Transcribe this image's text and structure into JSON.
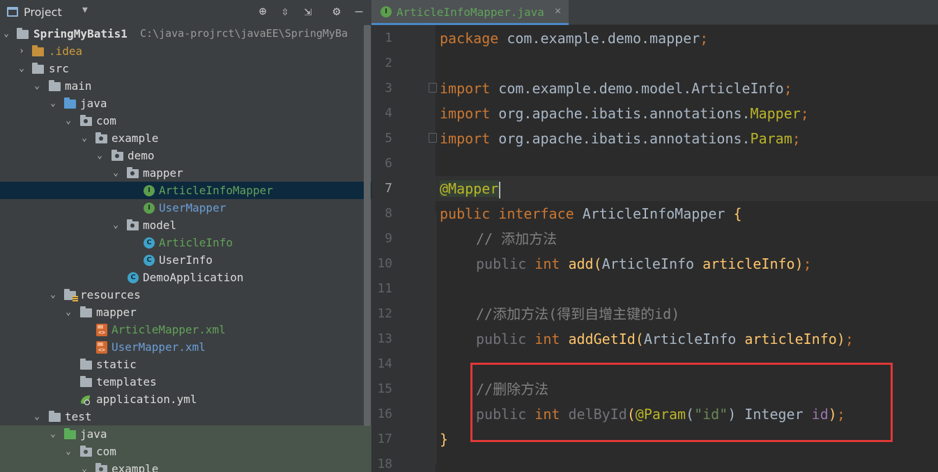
{
  "project_panel": {
    "title": "Project",
    "icons": {
      "dropdown": "chevron-down-icon",
      "locate": "crosshair-icon",
      "expand_all": "expand-all-icon",
      "collapse_all": "collapse-all-icon",
      "settings": "gear-icon",
      "hide": "minimize-icon"
    },
    "root": {
      "name": "SpringMyBatis1",
      "path": "C:\\java-projrct\\javaEE\\SpringMyBa"
    },
    "tree": {
      "idea": ".idea",
      "src": "src",
      "main": "main",
      "java": "java",
      "com": "com",
      "example": "example",
      "demo": "demo",
      "mapper": "mapper",
      "article_info_mapper": "ArticleInfoMapper",
      "user_mapper": "UserMapper",
      "model": "model",
      "article_info": "ArticleInfo",
      "user_info": "UserInfo",
      "demo_application": "DemoApplication",
      "resources": "resources",
      "res_mapper": "mapper",
      "article_mapper_xml": "ArticleMapper.xml",
      "user_mapper_xml": "UserMapper.xml",
      "static": "static",
      "templates": "templates",
      "application_yml": "application.yml",
      "test": "test",
      "test_java": "java",
      "test_com": "com",
      "test_example": "example"
    }
  },
  "editor": {
    "tab": {
      "label": "ArticleInfoMapper.java",
      "close": "✕"
    },
    "line_numbers": [
      "1",
      "2",
      "3",
      "4",
      "5",
      "6",
      "7",
      "8",
      "9",
      "10",
      "11",
      "12",
      "13",
      "14",
      "15",
      "16",
      "17",
      "18"
    ],
    "current_line": "7",
    "code": {
      "l1": {
        "kw": "package",
        "rest": " com.example.demo.mapper",
        "semi": ";"
      },
      "l3": {
        "kw": "import",
        "rest": " com.example.demo.model.ArticleInfo",
        "semi": ";"
      },
      "l4": {
        "kw": "import",
        "rest": " org.apache.ibatis.annotations.",
        "ann": "Mapper",
        "semi": ";"
      },
      "l5": {
        "kw": "import",
        "rest": " org.apache.ibatis.annotations.",
        "ann": "Param",
        "semi": ";"
      },
      "l7": {
        "ann": "@Mapper"
      },
      "l8": {
        "kw1": "public",
        "kw2": " interface",
        "name": " ArticleInfoMapper ",
        "brace": "{"
      },
      "l9": {
        "comment": "// 添加方法"
      },
      "l10": {
        "pub": "public",
        "int": " int",
        "fn": " add",
        "args_open": "(",
        "type": "ArticleInfo",
        "param": " articleInfo",
        "close": ")",
        "semi": ";"
      },
      "l12": {
        "comment": "//添加方法(得到自增主键的id)"
      },
      "l13": {
        "pub": "public",
        "int": " int",
        "fn": " addGetId",
        "args_open": "(",
        "type": "ArticleInfo",
        "param": " articleInfo",
        "close": ")",
        "semi": ";"
      },
      "l15": {
        "comment": "//删除方法"
      },
      "l16": {
        "pub": "public",
        "int": " int",
        "fn": " delById",
        "args_open": "(",
        "ann": "@Param",
        "str_open": "(",
        "str": "\"id\"",
        "str_close": ")",
        "type": " Integer",
        "param": " id",
        "close": ")",
        "semi": ";"
      },
      "l17": {
        "brace": "}"
      }
    }
  },
  "colors": {
    "keyword": "#cc7832",
    "annotation": "#bbb529",
    "comment": "#808080",
    "highlight_box": "#e23838"
  }
}
